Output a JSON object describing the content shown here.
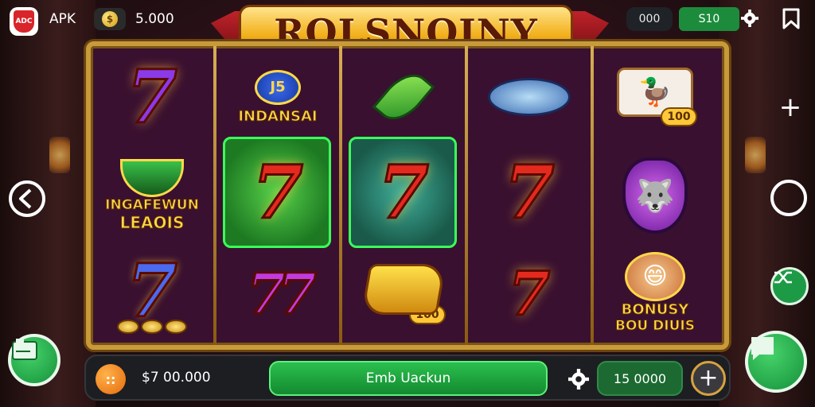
{
  "topbar": {
    "app_badge": "ADC",
    "apk_label": "APK",
    "coin_icon": "$",
    "coin_balance": "5.000",
    "right_pill_dark": "000",
    "right_pill_green": "S10"
  },
  "logo": {
    "text": "ROLSNOINY"
  },
  "reels": {
    "reel1": {
      "sym1": "7",
      "sym3_line1": "INGAFEWUN",
      "sym3_line2": "LEAOIS",
      "sym4": "7"
    },
    "reel2": {
      "badge": "J5",
      "banner": "INDANSAI",
      "sym2": "7",
      "sym3": "77"
    },
    "reel3": {
      "sym2": "7",
      "tag": "100"
    },
    "reel4": {
      "sym2": "7",
      "sym3": "7"
    },
    "reel5": {
      "tag": "100",
      "bonus_line1": "BONUSY",
      "bonus_line2": "BOU DIUIS"
    }
  },
  "bottombar": {
    "coin_icon": "::",
    "balance": "$7 00.000",
    "spin_label": "Emb Uackun",
    "bet_value": "15 0000",
    "plus": "+"
  },
  "side": {
    "plus": "+"
  },
  "colors": {
    "accent_green": "#1d9a45",
    "frame_gold": "#c99a3a",
    "spin_green": "#2bbf4e"
  }
}
